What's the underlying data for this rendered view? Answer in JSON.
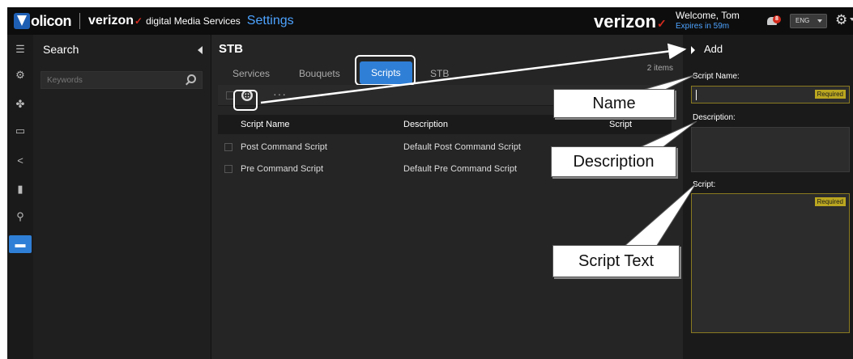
{
  "header": {
    "volicon_logo": "olicon",
    "verizon_logo_small": "verizon",
    "product_name": "digital Media Services",
    "section_title": "Settings",
    "verizon_logo_big": "verizon",
    "welcome_text": "Welcome, Tom",
    "expires_text": "Expires in 59m",
    "notification_count": "8",
    "language": "ENG",
    "accent_color": "#4da3ff",
    "brand_red": "#d52b1e"
  },
  "rail": {
    "icons": [
      "menu-icon",
      "gear-icon",
      "puzzle-icon",
      "monitor-icon",
      "share-icon",
      "clipboard-icon",
      "user-icon",
      "stb-icon"
    ],
    "active": "stb-icon",
    "active_color": "#2f7fd6"
  },
  "search": {
    "title": "Search",
    "placeholder": "Keywords"
  },
  "main": {
    "title": "STB",
    "tabs": [
      {
        "label": "Services"
      },
      {
        "label": "Bouquets"
      },
      {
        "label": "Scripts"
      },
      {
        "label": "STB"
      }
    ],
    "active_tab": "Scripts",
    "item_count": "2 items",
    "toolbar": {
      "add_icon": "⊕",
      "more": "···"
    },
    "table": {
      "headers": [
        "Script Name",
        "Description",
        "Script"
      ],
      "rows": [
        {
          "name": "Post Command Script",
          "description": "Default Post Command Script"
        },
        {
          "name": "Pre Command Script",
          "description": "Default Pre Command Script"
        }
      ]
    }
  },
  "add_panel": {
    "title": "Add",
    "script_name_label": "Script Name:",
    "description_label": "Description:",
    "script_label": "Script:",
    "required_text": "Required",
    "required_color": "#bba720"
  },
  "callouts": {
    "name": "Name",
    "description": "Description",
    "script_text": "Script Text"
  }
}
